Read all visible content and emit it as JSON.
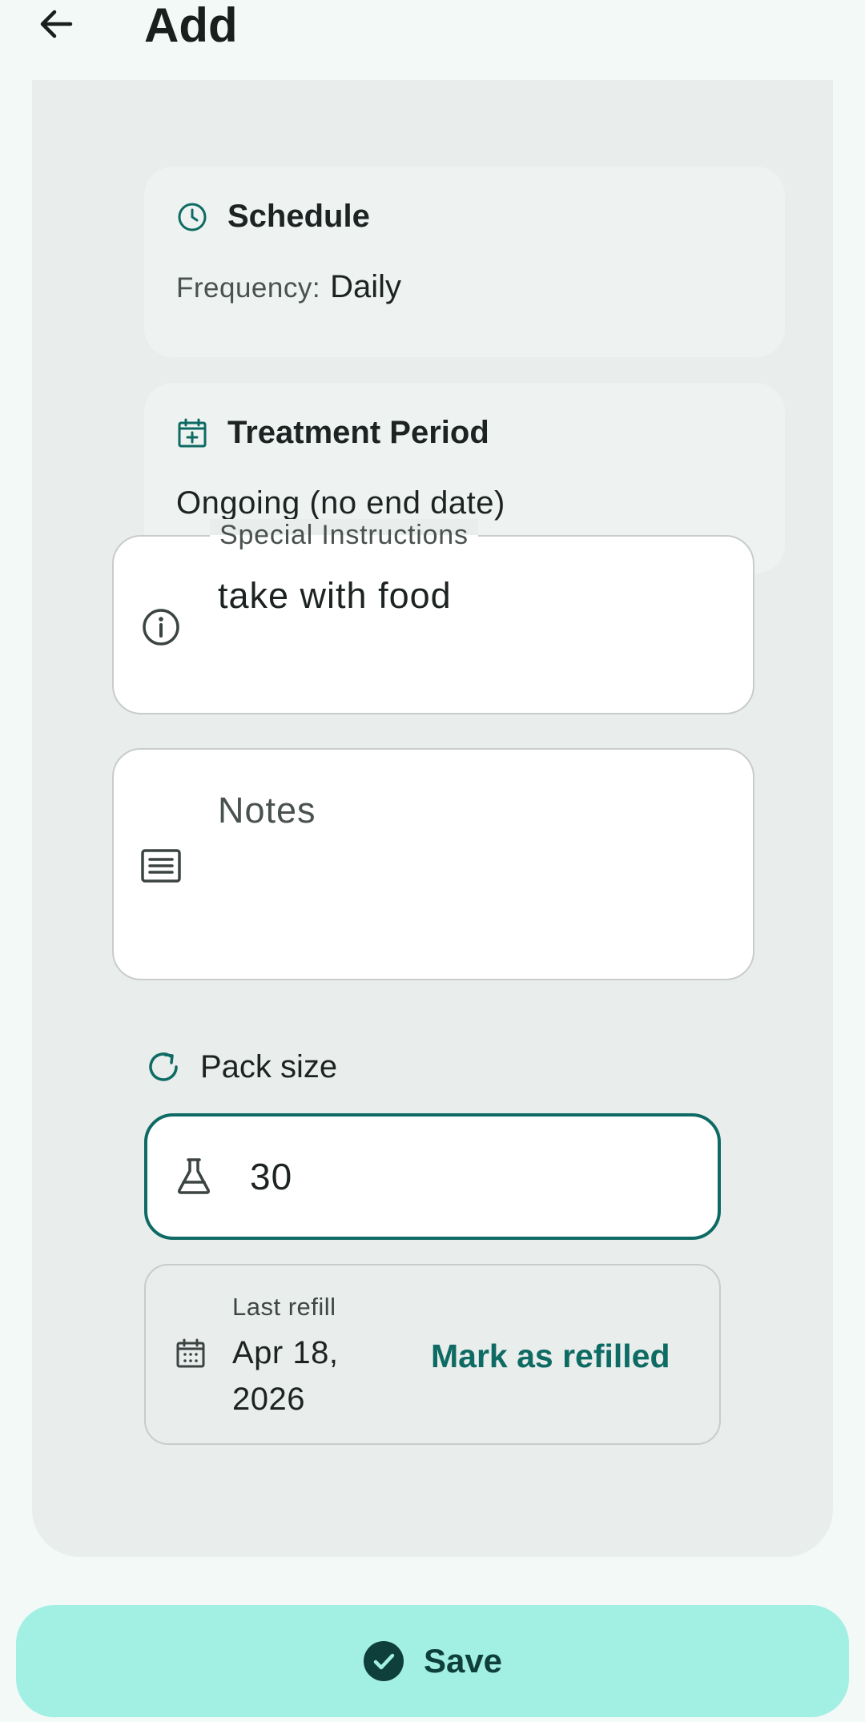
{
  "header": {
    "title": "Add",
    "back_icon": "arrow-left-icon"
  },
  "schedule": {
    "title": "Schedule",
    "icon": "clock-icon",
    "frequency_label": "Frequency:",
    "frequency_value": "Daily"
  },
  "treatment_period": {
    "title": "Treatment Period",
    "icon": "calendar-plus-icon",
    "value": "Ongoing (no end date)"
  },
  "special_instructions": {
    "label": "Special Instructions",
    "value": "take with food",
    "icon": "info-icon"
  },
  "notes": {
    "placeholder": "Notes",
    "icon": "notes-icon"
  },
  "pack": {
    "label": "Pack size",
    "icon": "refresh-icon",
    "value": "30",
    "input_icon": "flask-icon"
  },
  "refill": {
    "label": "Last refill",
    "date": "Apr 18, 2026",
    "action": "Mark as refilled",
    "icon": "calendar-icon"
  },
  "save": {
    "label": "Save",
    "icon": "check-circle-icon"
  },
  "colors": {
    "accent": "#0e6b63",
    "save_bg": "#a2efe3",
    "background": "#f3f9f7",
    "panel": "#e9edec"
  }
}
